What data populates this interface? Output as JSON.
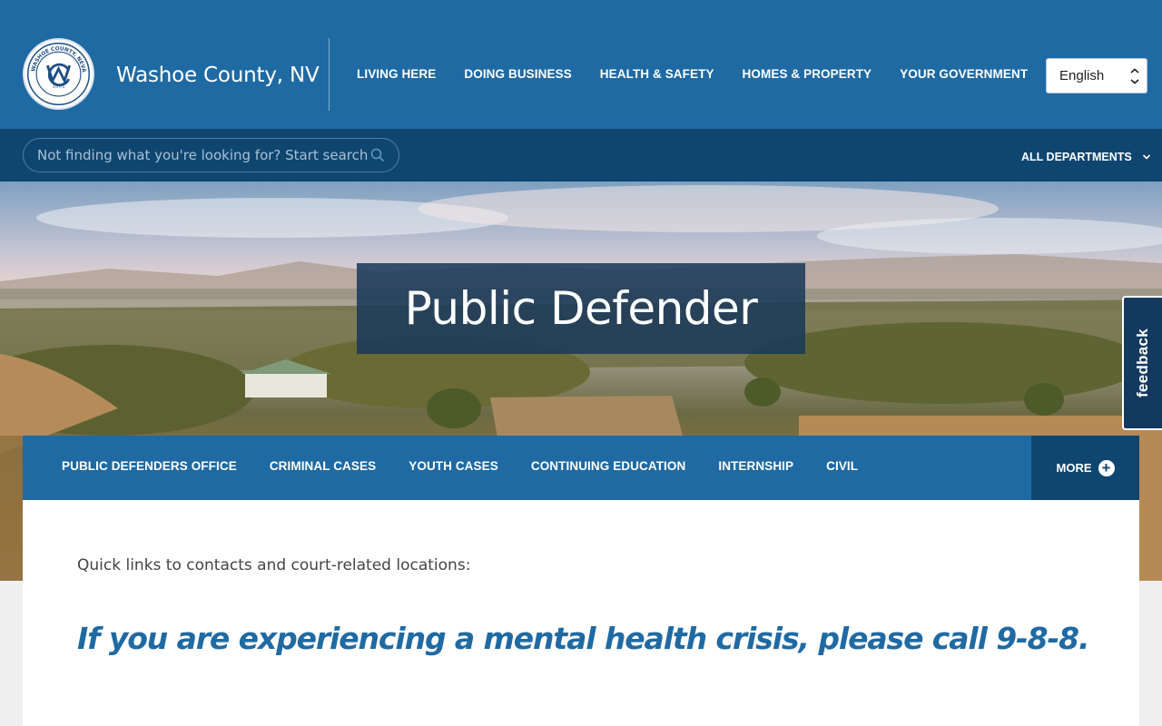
{
  "header": {
    "site_title": "Washoe County, NV",
    "logo": {
      "ring_text": "WASHOE COUNTY, NEVADA",
      "year": "1861"
    },
    "nav": [
      {
        "label": "LIVING HERE"
      },
      {
        "label": "DOING BUSINESS"
      },
      {
        "label": "HEALTH & SAFETY"
      },
      {
        "label": "HOMES & PROPERTY"
      },
      {
        "label": "YOUR GOVERNMENT"
      }
    ],
    "language": {
      "selected": "English"
    }
  },
  "subbar": {
    "search_placeholder": "Not finding what you're looking for? Start searching.",
    "all_departments": "ALL DEPARTMENTS"
  },
  "hero": {
    "title": "Public Defender"
  },
  "feedback": {
    "label": "feedback"
  },
  "section_nav": {
    "items": [
      {
        "label": "PUBLIC DEFENDERS OFFICE"
      },
      {
        "label": "CRIMINAL CASES"
      },
      {
        "label": "YOUTH CASES"
      },
      {
        "label": "CONTINUING EDUCATION"
      },
      {
        "label": "INTERNSHIP"
      },
      {
        "label": "CIVIL"
      }
    ],
    "more_label": "MORE"
  },
  "content": {
    "quick_links": "Quick links to contacts and court-related locations:",
    "crisis": "If you are experiencing a mental health crisis, please call 9-8-8."
  },
  "colors": {
    "primary_blue": "#1f6aa3",
    "dark_blue": "#0f4670"
  },
  "icons": [
    "county-seal-logo",
    "search-icon",
    "chevron-down-icon",
    "plus-circle-icon"
  ]
}
